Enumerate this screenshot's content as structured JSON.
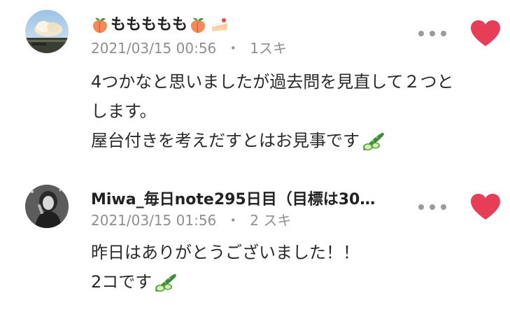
{
  "comments": [
    {
      "name": "ももももも",
      "timestamp": "2021/03/15 00:56",
      "separator": "・",
      "likes": "1スキ",
      "body_lines": [
        "4つかなと思いましたが過去問を見直して２つと",
        "します。",
        "屋台付きを考えだすとはお見事です"
      ],
      "name_icons": [
        "peach-icon",
        "peach-icon",
        "cake-icon"
      ],
      "body_icon": "cucumber-icon"
    },
    {
      "name": "Miwa_毎日note295日目（目標は30…",
      "timestamp": "2021/03/15 01:56",
      "separator": "・",
      "likes": "2 スキ",
      "body_lines": [
        "昨日はありがとうございました！！",
        "2コです"
      ],
      "body_icon": "cucumber-icon"
    }
  ],
  "colors": {
    "heart": "#e63e57",
    "meta": "#8f8f8f",
    "menu_dots": "#9b9b9b"
  }
}
